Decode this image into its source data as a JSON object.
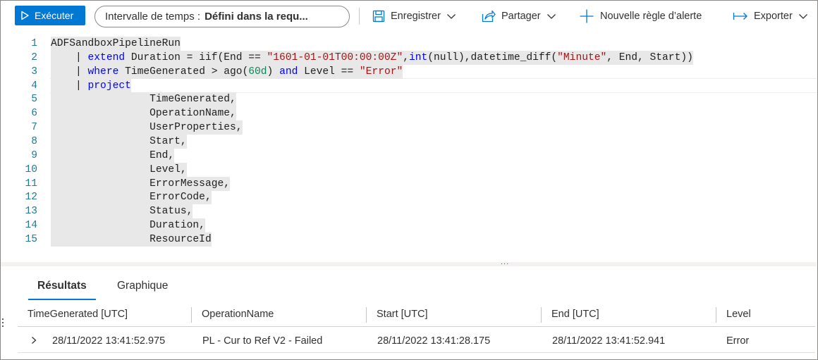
{
  "toolbar": {
    "run_label": "Exécuter",
    "time_range_label": "Intervalle de temps :",
    "time_range_value": "Défini dans la requ...",
    "save_label": "Enregistrer",
    "share_label": "Partager",
    "new_alert_label": "Nouvelle règle d’alerte",
    "export_label": "Exporter",
    "accent_color": "#0078d4"
  },
  "editor": {
    "line_numbers": [
      "1",
      "2",
      "3",
      "4",
      "5",
      "6",
      "7",
      "8",
      "9",
      "10",
      "11",
      "12",
      "13",
      "14",
      "15"
    ],
    "lines": [
      [
        {
          "t": "ADFSandboxPipelineRun",
          "c": ""
        }
      ],
      [
        {
          "t": "    | ",
          "c": ""
        },
        {
          "t": "extend",
          "c": "kw"
        },
        {
          "t": " Duration = iif(End == ",
          "c": ""
        },
        {
          "t": "\"1601-01-01T00:00:00Z\"",
          "c": "str"
        },
        {
          "t": ",",
          "c": ""
        },
        {
          "t": "int",
          "c": "kw"
        },
        {
          "t": "(null),datetime_diff(",
          "c": ""
        },
        {
          "t": "\"Minute\"",
          "c": "str"
        },
        {
          "t": ", End, Start))",
          "c": ""
        }
      ],
      [
        {
          "t": "    | ",
          "c": ""
        },
        {
          "t": "where",
          "c": "kw"
        },
        {
          "t": " TimeGenerated > ago(",
          "c": ""
        },
        {
          "t": "60d",
          "c": "num"
        },
        {
          "t": ") ",
          "c": ""
        },
        {
          "t": "and",
          "c": "kw"
        },
        {
          "t": " Level == ",
          "c": ""
        },
        {
          "t": "\"Error\"",
          "c": "str"
        }
      ],
      [
        {
          "t": "    | ",
          "c": ""
        },
        {
          "t": "project",
          "c": "kw"
        }
      ],
      [
        {
          "t": "                TimeGenerated,",
          "c": ""
        }
      ],
      [
        {
          "t": "                OperationName,",
          "c": ""
        }
      ],
      [
        {
          "t": "                UserProperties,",
          "c": ""
        }
      ],
      [
        {
          "t": "                Start,",
          "c": ""
        }
      ],
      [
        {
          "t": "                End,",
          "c": ""
        }
      ],
      [
        {
          "t": "                Level,",
          "c": ""
        }
      ],
      [
        {
          "t": "                ErrorMessage,",
          "c": ""
        }
      ],
      [
        {
          "t": "                ErrorCode,",
          "c": ""
        }
      ],
      [
        {
          "t": "                Status,",
          "c": ""
        }
      ],
      [
        {
          "t": "                Duration,",
          "c": ""
        }
      ],
      [
        {
          "t": "                ResourceId",
          "c": ""
        }
      ]
    ]
  },
  "splitter_handle": "...",
  "tabs": {
    "results": "Résultats",
    "chart": "Graphique"
  },
  "grid": {
    "columns": [
      "TimeGenerated [UTC]",
      "OperationName",
      "Start [UTC]",
      "End [UTC]",
      "Level"
    ],
    "rows": [
      [
        "28/11/2022 13:41:52.975",
        "PL - Cur to Ref V2 - Failed",
        "28/11/2022 13:41:28.175",
        "28/11/2022 13:41:52.941",
        "Error"
      ]
    ]
  }
}
